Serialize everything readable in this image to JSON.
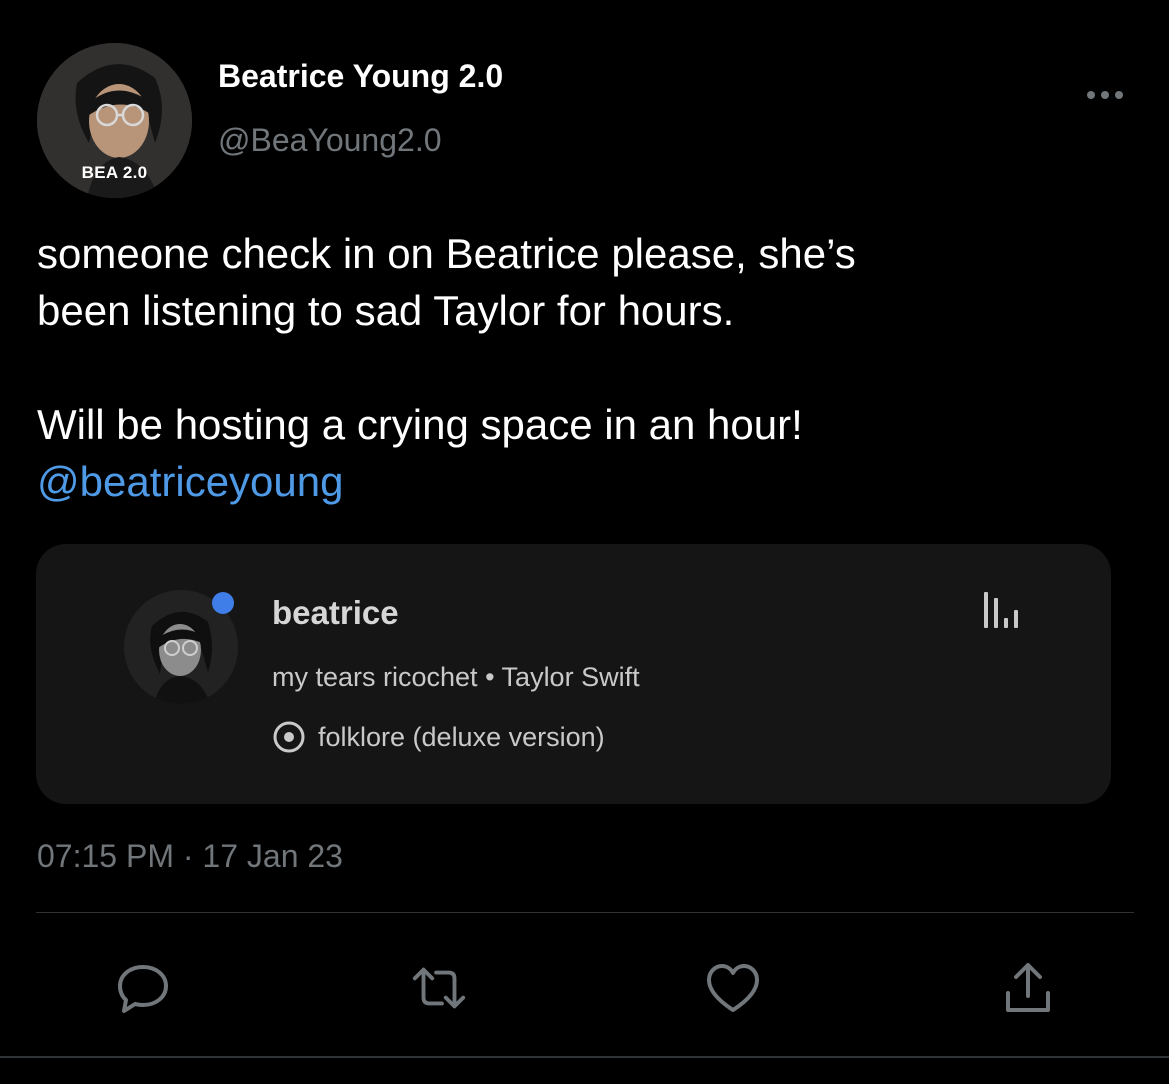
{
  "tweet": {
    "author": {
      "display_name": "Beatrice Young 2.0",
      "handle": "@BeaYoung2.0",
      "avatar_caption": "BEA 2.0"
    },
    "text_line1": "someone check in on Beatrice please, she’s",
    "text_line2": "been listening to sad Taylor for hours.",
    "text_line3": "Will be hosting a crying space in an hour!",
    "mention": "@beatriceyoung",
    "timestamp": "07:15 PM · 17 Jan 23",
    "actions": [
      "reply-icon",
      "retweet-icon",
      "like-icon",
      "share-icon"
    ]
  },
  "now_playing": {
    "user": "beatrice",
    "track": "my tears ricochet",
    "separator": "•",
    "artist": "Taylor Swift",
    "album": "folklore (deluxe version)",
    "online_indicator_color": "#3f7ee8",
    "icons": [
      "album-icon",
      "equalizer-icon"
    ]
  },
  "colors": {
    "background": "#000000",
    "text": "#ffffff",
    "secondary_text": "#71767b",
    "link": "#4f9ae6",
    "card_background": "#151515"
  }
}
